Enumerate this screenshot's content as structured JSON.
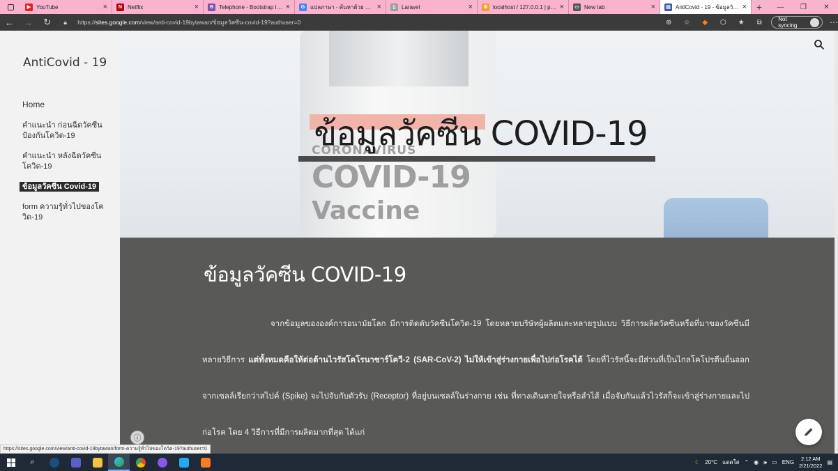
{
  "browser": {
    "tabs": [
      {
        "title": "YouTube",
        "icon": "youtube-icon",
        "color": "#e62117",
        "glyph": "▶"
      },
      {
        "title": "Netflix",
        "icon": "netflix-icon",
        "color": "#b1060f",
        "glyph": "N"
      },
      {
        "title": "Telephone - Bootstrap Icons",
        "icon": "bootstrap-icon",
        "color": "#7952b3",
        "glyph": "B"
      },
      {
        "title": "แปลภาษา - ค้นหาด้วย Google",
        "icon": "google-icon",
        "color": "#4285f4",
        "glyph": "G"
      },
      {
        "title": "Laravel",
        "icon": "document-icon",
        "color": "#9e9e9e",
        "glyph": "▯"
      },
      {
        "title": "localhost / 127.0.0.1 | phpMyAdmin",
        "icon": "phpmyadmin-icon",
        "color": "#f0a028",
        "glyph": "⚙"
      },
      {
        "title": "New tab",
        "icon": "newtab-icon",
        "color": "#555555",
        "glyph": "▭"
      },
      {
        "title": "AntiCovid - 19 - ข้อมูลวัคซีน",
        "icon": "google-sites-icon",
        "color": "#3b5ba9",
        "glyph": "▤"
      }
    ],
    "url_scheme": "https://",
    "url_host": "sites.google.com",
    "url_path": "/view/anti-covid-19bytawan/ข้อมูลวัคซีน-covid-19?authuser=0",
    "sync_label": "Not syncing",
    "status_link": "https://sites.google.com/view/anti-covid-19bytawan/form-ความรู้ทั่วไปของโควิด-19?authuser=0"
  },
  "site": {
    "title": "AntiCovid - 19",
    "nav": [
      {
        "label": "Home"
      },
      {
        "label": "คำแนะนำ ก่อนฉีดวัคซีนป้องกันโควิด-19"
      },
      {
        "label": "คำแนะนำ หลังฉีดวัคซีนโควิด-19"
      },
      {
        "label": "ข้อมูลวัคซีน Covid-19"
      },
      {
        "label": "form ความรู้ทั่วไปของโควิด-19"
      }
    ],
    "hero_title": "ข้อมูลวัคซีน COVID-19",
    "hero_image_text": {
      "line1": "CORONAVIRUS",
      "line2": "COVID-19",
      "line3": "Vaccine"
    },
    "heading": "ข้อมูลวัคซีน COVID-19",
    "para_part1": "จากข้อมูลขององค์การอนามัยโลก มีการติดตับวัคซีนโควิด-19 โดยหลายบริษัทผู้ผลิตและหลายรูปแบบ วิธีการผลิตวัคซีนหรือที่มาของวัคซีนมีหลายวิธีการ ",
    "para_bold": "แต่ทั้งหมดคือให้ต่อต้านไวรัสโคโรนาซาร์โควี-2 (SAR-CoV-2) ไม่ให้เข้าสู่ร่างกายเพื่อไปก่อโรคได้",
    "para_part2": " โดยที่ไวรัสนี้จะมีส่วนที่เป็นไกลโคโปรตีนยื่นออกจากเซลล์เรียกว่าสไปค์ (Spike) จะไปจับกับตัวรับ (Receptor) ที่อยู่บนเซลล์ในร่างกาย เช่น ที่ทางเดินหายใจหรือลำไส้ เมื่อจับกันแล้วไวรัสก็จะเข้าสู่ร่างกายและไปก่อโรค โดย 4 วิธีการที่มีการผลิตมากที่สุด ได้แก่"
  },
  "taskbar": {
    "weather": "20°C",
    "weather_desc": "แดดใส",
    "lang": "ENG",
    "time": "2:12 AM",
    "date": "2/21/2022"
  },
  "colors": {
    "tabstrip": "#f9b3cf",
    "content_bg": "#595957",
    "sidebar_bg": "#f2f2f2"
  }
}
